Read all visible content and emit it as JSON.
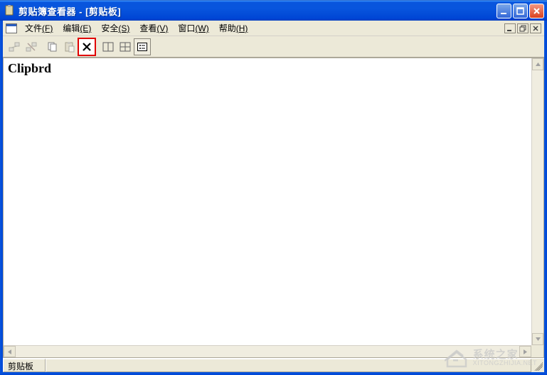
{
  "titlebar": {
    "app_title": "剪贴簿查看器",
    "separator": " - ",
    "doc_title": "[剪贴板]"
  },
  "menu": {
    "file": {
      "label": "文件",
      "accel": "(F)"
    },
    "edit": {
      "label": "编辑",
      "accel": "(E)"
    },
    "security": {
      "label": "安全",
      "accel": "(S)"
    },
    "view": {
      "label": "查看",
      "accel": "(V)"
    },
    "window": {
      "label": "窗口",
      "accel": "(W)"
    },
    "help": {
      "label": "帮助",
      "accel": "(H)"
    }
  },
  "toolbar": {
    "icons": {
      "connect": "connect-icon",
      "disconnect": "disconnect-icon",
      "copy": "copy-icon",
      "paste": "paste-icon",
      "delete": "delete-icon",
      "tile": "tile-icon",
      "cascade": "cascade-icon",
      "list": "list-icon"
    }
  },
  "content": {
    "text": "Clipbrd"
  },
  "statusbar": {
    "panel1": "剪贴板"
  },
  "watermark": {
    "cn": "系统之家",
    "en": "XITONGZHIJIA.NET"
  }
}
